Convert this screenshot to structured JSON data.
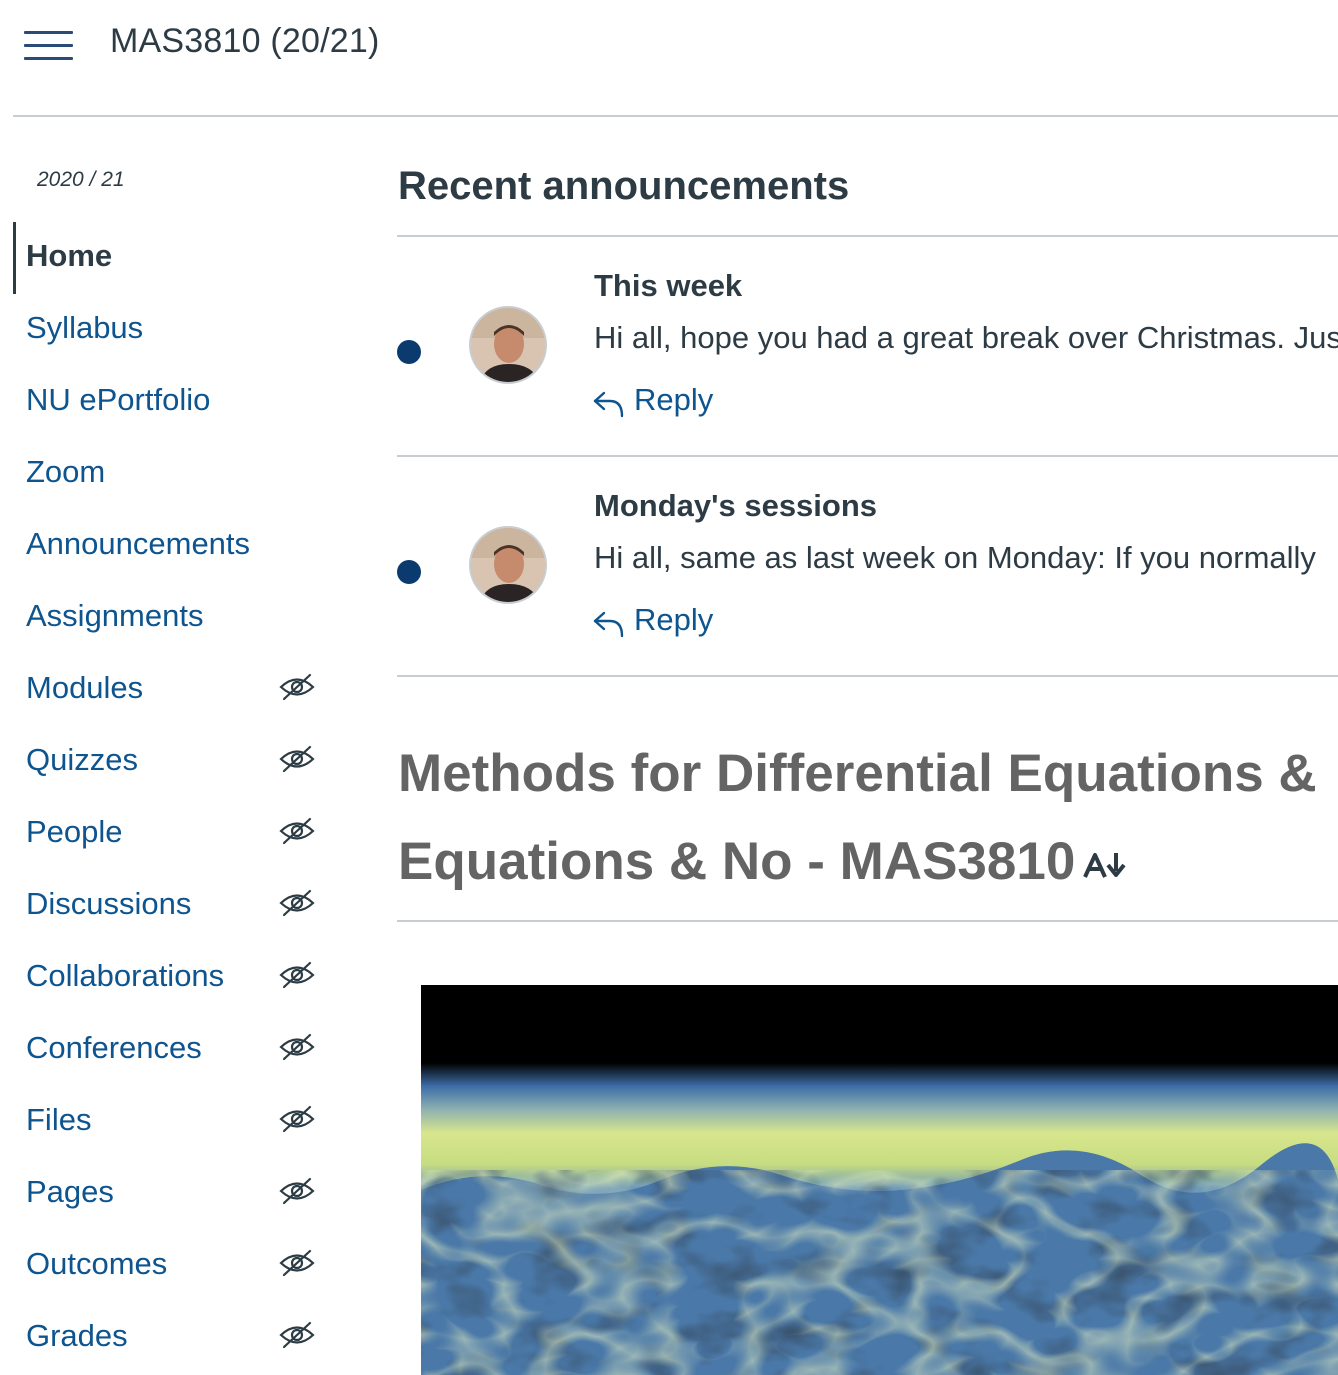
{
  "header": {
    "course_title": "MAS3810 (20/21)"
  },
  "sidebar": {
    "term": "2020 / 21",
    "items": [
      {
        "label": "Home",
        "active": true,
        "hidden": false
      },
      {
        "label": "Syllabus",
        "active": false,
        "hidden": false
      },
      {
        "label": "NU ePortfolio",
        "active": false,
        "hidden": false
      },
      {
        "label": "Zoom",
        "active": false,
        "hidden": false
      },
      {
        "label": "Announcements",
        "active": false,
        "hidden": false
      },
      {
        "label": "Assignments",
        "active": false,
        "hidden": false
      },
      {
        "label": "Modules",
        "active": false,
        "hidden": true
      },
      {
        "label": "Quizzes",
        "active": false,
        "hidden": true
      },
      {
        "label": "People",
        "active": false,
        "hidden": true
      },
      {
        "label": "Discussions",
        "active": false,
        "hidden": true
      },
      {
        "label": "Collaborations",
        "active": false,
        "hidden": true
      },
      {
        "label": "Conferences",
        "active": false,
        "hidden": true
      },
      {
        "label": "Files",
        "active": false,
        "hidden": true
      },
      {
        "label": "Pages",
        "active": false,
        "hidden": true
      },
      {
        "label": "Outcomes",
        "active": false,
        "hidden": true
      },
      {
        "label": "Grades",
        "active": false,
        "hidden": true
      }
    ]
  },
  "main": {
    "recent_title": "Recent announcements",
    "announcements": [
      {
        "title": "This week",
        "preview": "Hi all, hope you had a great break over Christmas. Jus",
        "reply_label": "Reply"
      },
      {
        "title": "Monday's sessions",
        "preview": "Hi all,  same as last week on Monday: If you normally",
        "reply_label": "Reply"
      }
    ],
    "heading_line1": "Methods for Differential Equations &",
    "heading_line2": "Equations & No - MAS3810"
  },
  "colors": {
    "link": "#0e548f",
    "text": "#2d3b45",
    "unread_dot": "#0b3a6e",
    "rule": "#c7cdd1",
    "heading_gray": "#646464"
  }
}
